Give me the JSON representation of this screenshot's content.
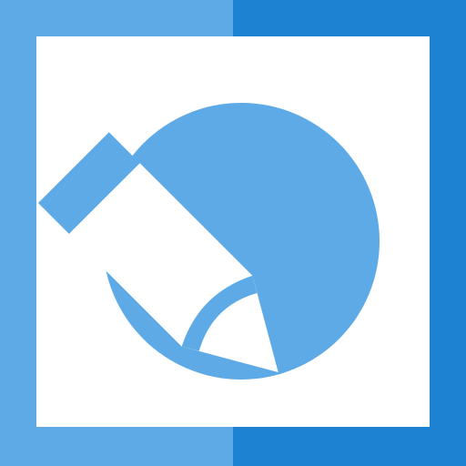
{
  "icon": {
    "name": "edit-pencil-app-icon",
    "colors": {
      "left_panel": "#5DAAE7",
      "right_panel": "#1E82D2",
      "inner_square": "#FFFFFF",
      "circle": "#5DAAE7",
      "pencil_body": "#FFFFFF",
      "pencil_accent": "#5DAAE7"
    }
  }
}
